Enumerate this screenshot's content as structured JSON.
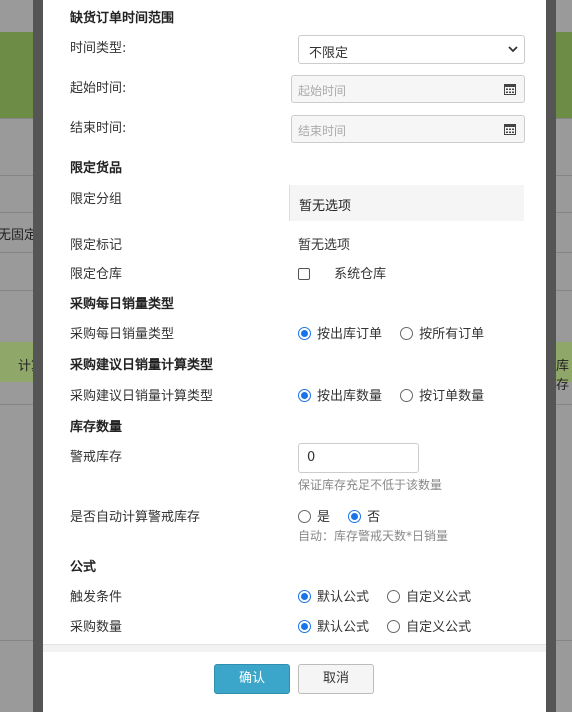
{
  "background": {
    "left_text_1": "无固定量",
    "left_text_2": "计算",
    "right_text": "库存"
  },
  "sections": {
    "oos_time_range": "缺货订单时间范围",
    "limit_goods": "限定货品",
    "daily_sales_type": "采购每日销量类型",
    "suggest_calc_type": "采购建议日销量计算类型",
    "stock_qty": "库存数量",
    "formula": "公式"
  },
  "fields": {
    "time_type": {
      "label": "时间类型:",
      "value": "不限定"
    },
    "start_time": {
      "label": "起始时间:",
      "placeholder": "起始时间"
    },
    "end_time": {
      "label": "结束时间:",
      "placeholder": "结束时间"
    },
    "limit_group": {
      "label": "限定分组",
      "value": "暂无选项"
    },
    "limit_mark": {
      "label": "限定标记",
      "value": "暂无选项"
    },
    "limit_warehouse": {
      "label": "限定仓库",
      "option": "系统仓库"
    },
    "daily_sales": {
      "label": "采购每日销量类型",
      "opt1": "按出库订单",
      "opt2": "按所有订单"
    },
    "suggest_calc": {
      "label": "采购建议日销量计算类型",
      "opt1": "按出库数量",
      "opt2": "按订单数量"
    },
    "alert_stock": {
      "label": "警戒库存",
      "value": "0",
      "hint": "保证库存充足不低于该数量"
    },
    "auto_calc": {
      "label": "是否自动计算警戒库存",
      "opt1": "是",
      "opt2": "否",
      "hint": "自动：库存警戒天数*日销量"
    },
    "trigger": {
      "label": "触发条件",
      "opt1": "默认公式",
      "opt2": "自定义公式"
    },
    "purchase_qty": {
      "label": "采购数量",
      "opt1": "默认公式",
      "opt2": "自定义公式"
    }
  },
  "footer": {
    "confirm": "确认",
    "cancel": "取消"
  }
}
